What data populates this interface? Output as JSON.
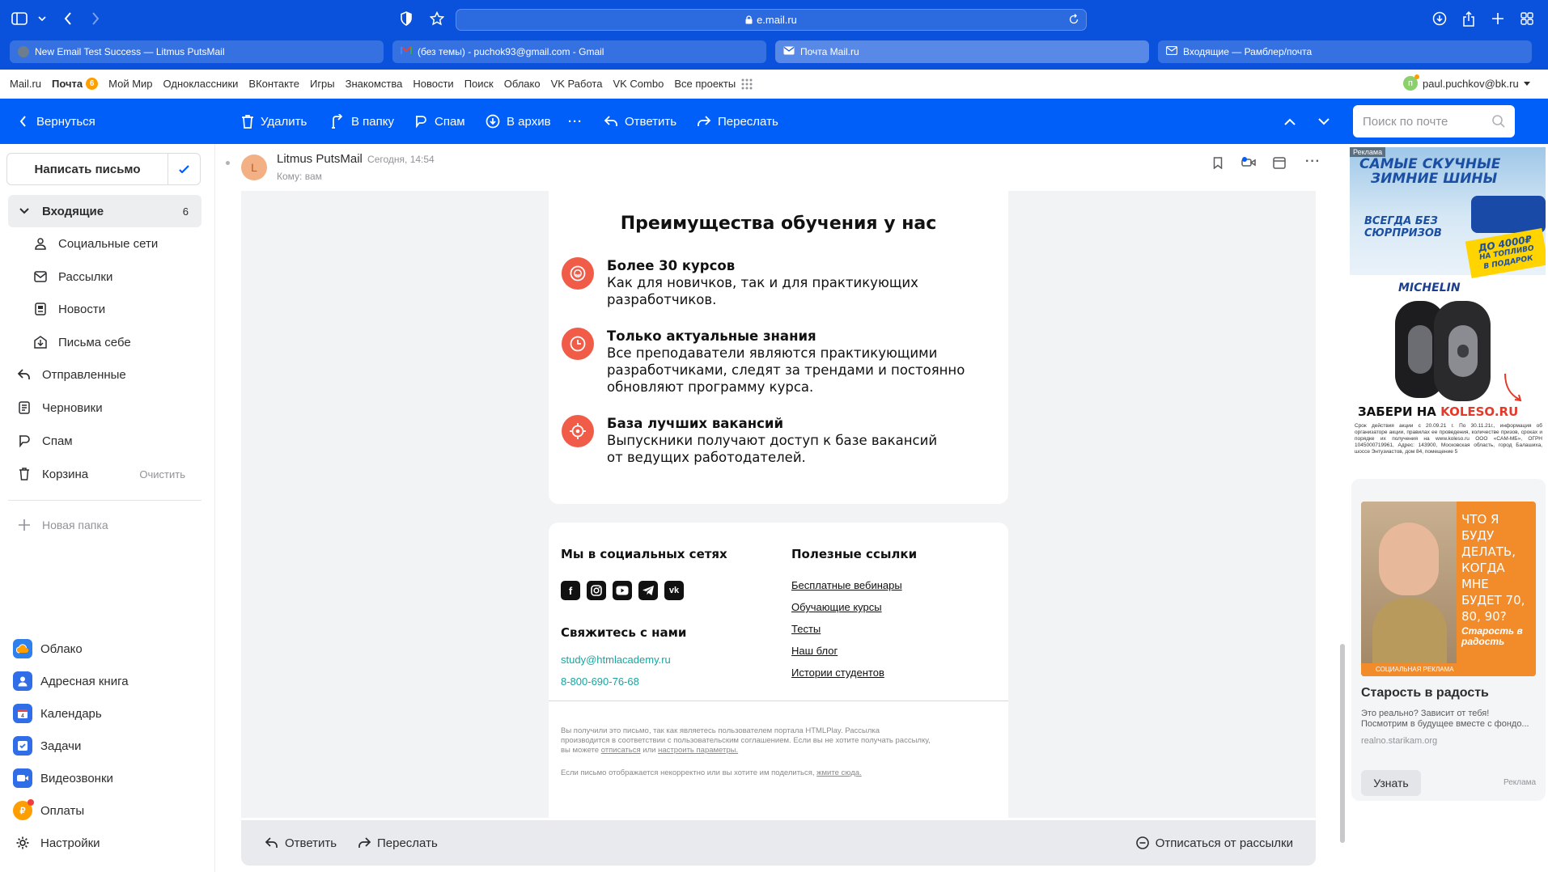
{
  "browser": {
    "url": "e.mail.ru",
    "tabs": [
      {
        "title": "New Email Test Success — Litmus PutsMail",
        "favicon_color": "#6b7d8f"
      },
      {
        "title": "(без темы) - puchok93@gmail.com - Gmail",
        "favicon_color": "#e94235"
      },
      {
        "title": "Почта Mail.ru",
        "favicon_color": "#ffffff"
      },
      {
        "title": "Входящие — Рамблер/почта",
        "favicon_color": "#ffffff"
      }
    ]
  },
  "portal": {
    "links": [
      "Mail.ru",
      "Почта",
      "Мой Мир",
      "Одноклассники",
      "ВКонтакте",
      "Игры",
      "Знакомства",
      "Новости",
      "Поиск",
      "Облако",
      "VK Работа",
      "VK Combo",
      "Все проекты"
    ],
    "mail_badge": "6",
    "user_initial": "п",
    "user_email": "paul.puchkov@bk.ru"
  },
  "toolbar": {
    "back": "Вернуться",
    "delete": "Удалить",
    "move": "В папку",
    "spam": "Спам",
    "archive": "В архив",
    "more": "···",
    "reply": "Ответить",
    "forward": "Переслать",
    "search_placeholder": "Поиск по почте"
  },
  "sidebar": {
    "compose": "Написать письмо",
    "folders": [
      {
        "label": "Входящие",
        "count": "6",
        "icon": "chevron-down-icon"
      },
      {
        "label": "Социальные сети",
        "icon": "social-icon"
      },
      {
        "label": "Рассылки",
        "icon": "newsletter-icon"
      },
      {
        "label": "Новости",
        "icon": "news-icon"
      },
      {
        "label": "Письма себе",
        "icon": "self-mail-icon"
      },
      {
        "label": "Отправленные",
        "icon": "sent-icon"
      },
      {
        "label": "Черновики",
        "icon": "draft-icon"
      },
      {
        "label": "Спам",
        "icon": "spam-icon"
      },
      {
        "label": "Корзина",
        "action": "Очистить",
        "icon": "trash-icon"
      }
    ],
    "new_folder": "Новая папка",
    "apps": [
      {
        "label": "Облако",
        "color": "#2f80ed"
      },
      {
        "label": "Адресная книга",
        "color": "#2f6ee6"
      },
      {
        "label": "Календарь",
        "color": "#2f6ee6"
      },
      {
        "label": "Задачи",
        "color": "#2f6ee6"
      },
      {
        "label": "Видеозвонки",
        "color": "#2f6ee6"
      },
      {
        "label": "Оплаты",
        "color": "#ff9e00"
      },
      {
        "label": "Настройки",
        "color": "#ffffff"
      }
    ]
  },
  "message": {
    "sender_initial": "L",
    "sender": "Litmus PutsMail",
    "time": "Сегодня, 14:54",
    "to": "Кому: вам",
    "heading": "Преимущества обучения у нас",
    "features": [
      {
        "title": "Более 30 курсов",
        "lines": [
          "Как для новичков, так и для практикующих",
          "разработчиков."
        ]
      },
      {
        "title": "Только актуальные знания",
        "lines": [
          "Все преподаватели являются практикующими",
          "разработчиками, следят за трендами и постоянно",
          "обновляют программу курса."
        ]
      },
      {
        "title": "База лучших вакансий",
        "lines": [
          "Выпускники получают доступ к базе вакансий",
          "от ведущих работодателей."
        ]
      }
    ],
    "social_heading": "Мы в социальных сетях",
    "social_icons": [
      "facebook-icon",
      "instagram-icon",
      "youtube-icon",
      "telegram-icon",
      "vk-icon"
    ],
    "contact_heading": "Свяжитесь с нами",
    "email": "study@htmlacademy.ru",
    "phone": "8-800-690-76-68",
    "links_heading": "Полезные ссылки",
    "links": [
      "Бесплатные вебинары",
      "Обучающие курсы",
      "Тесты",
      "Наш блог",
      "Истории студентов"
    ],
    "footer_line1": "Вы получили это письмо, так как являетесь пользователем портала HTMLPlay. Рассылка",
    "footer_line2": "производится в соответствии с пользовательским соглашением. Если вы не хотите получать рассылку,",
    "footer_line3_a": "вы можете",
    "footer_unsub": "отписаться",
    "footer_line3_b": "или",
    "footer_settings": "настроить параметры.",
    "footer_line4": "Если письмо отображается некорректно или вы хотите им поделиться,",
    "footer_here": "жмите сюда."
  },
  "bottom": {
    "reply": "Ответить",
    "forward": "Переслать",
    "unsubscribe": "Отписаться от рассылки"
  },
  "ads": {
    "ad1": {
      "badge": "Реклама",
      "line1": "САМЫЕ СКУЧНЫЕ",
      "line2": "ЗИМНИЕ ШИНЫ",
      "sub1": "ВСЕГДА БЕЗ",
      "sub2": "СЮРПРИЗОВ",
      "promo1": "ДО 4000₽",
      "promo2": "НА ТОПЛИВО",
      "promo3": "В ПОДАРОК",
      "brand": "MICHELIN",
      "cta_a": "ЗАБЕРИ НА",
      "cta_b": "KOLESO.RU",
      "legal": "Срок действия акции с 20.09.21 г. По 30.11.21г., информация об организаторе акции, правилах ее проведения, количестве призов, сроках и порядке их получения на www.koleso.ru ООО «САМ-МБ», ОГРН 1045000719961, Адрес: 143900, Московская область, город Балашиха, шоссе Энтузиастов, дом 84, помещение 5"
    },
    "ad2": {
      "headline": "ЧТО Я БУДУ ДЕЛАТЬ, КОГДА МНЕ БУДЕТ 70, 80, 90?",
      "logo": "Старость в радость",
      "social_label": "СОЦИАЛЬНАЯ РЕКЛАМА",
      "title": "Старость в радость",
      "desc1": "Это реально? Зависит от тебя!",
      "desc2": "Посмотрим в будущее вместе с фондо...",
      "domain": "realno.starikam.org",
      "button": "Узнать",
      "label": "Реклама"
    }
  }
}
